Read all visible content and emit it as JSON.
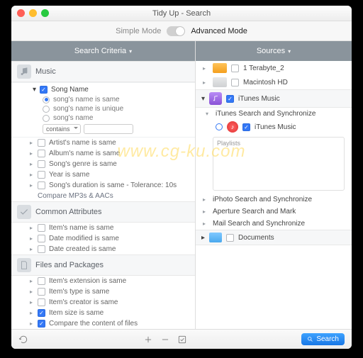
{
  "window_title": "Tidy Up - Search",
  "mode": {
    "simple": "Simple Mode",
    "advanced": "Advanced Mode"
  },
  "left": {
    "header": "Search Criteria",
    "sections": [
      {
        "title": "Music"
      },
      {
        "title": "Common Attributes"
      },
      {
        "title": "Files and Packages"
      }
    ],
    "music_group": {
      "song_name": "Song Name",
      "opt_same": "song's name is same",
      "opt_unique": "song's name is unique",
      "opt_plain": "song's name",
      "contains": "contains",
      "artist": "Artist's name is same",
      "album": "Album's name is same",
      "genre": "Song's genre is same",
      "year": "Year is same",
      "duration": "Song's duration is same - Tolerance: 10s",
      "compare": "Compare MP3s & AACs"
    },
    "common": {
      "item_name": "Item's name is same",
      "date_mod": "Date modified is same",
      "date_created": "Date created is same"
    },
    "files_pkg": {
      "ext": "Item's extension is same",
      "type": "Item's type is same",
      "creator": "Item's creator is same",
      "size": "Item size is same",
      "compare_content": "Compare the content of files"
    }
  },
  "right": {
    "header": "Sources",
    "vol_ext": "1 Terabyte_2",
    "vol_int": "Macintosh HD",
    "itunes_music": "iTunes Music",
    "itunes_sync": "iTunes Search and Synchronize",
    "playlists": "Playlists",
    "iphoto": "iPhoto Search and Synchronize",
    "aperture": "Aperture Search and Mark",
    "mail": "Mail Search and Synchronize",
    "documents": "Documents"
  },
  "footer": {
    "search": "Search"
  },
  "watermark": "www.cg-ku.com"
}
